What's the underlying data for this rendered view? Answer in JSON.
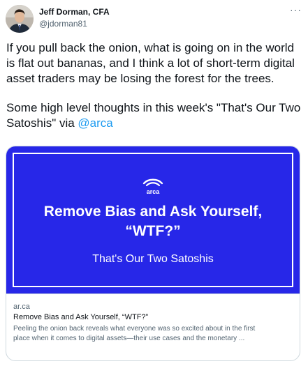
{
  "author": {
    "name": "Jeff Dorman, CFA",
    "handle": "@jdorman81"
  },
  "more_menu": "···",
  "tweet": {
    "paragraph1": "If you pull back the onion, what is going on in the world is flat out bananas, and I think a lot of short-term digital asset traders may be losing the forest for the trees.",
    "paragraph2_text": "Some high level thoughts in this week's \"That's Our Two Satoshis\" via ",
    "mention": "@arca"
  },
  "card": {
    "image": {
      "logo_text": "arca",
      "headline_line1": "Remove Bias and Ask Yourself,",
      "headline_line2": "“WTF?”",
      "subheadline": "That's Our Two Satoshis",
      "background_color": "#2727e8"
    },
    "domain": "ar.ca",
    "title": "Remove Bias and Ask Yourself, “WTF?”",
    "description_line1": "Peeling the onion back reveals what everyone was so excited about in the first",
    "description_line2": "place when it comes to digital assets—their use cases and the monetary ..."
  },
  "colors": {
    "link": "#1d9bf0",
    "secondary_text": "#536471",
    "card_border": "#cfd9de"
  }
}
